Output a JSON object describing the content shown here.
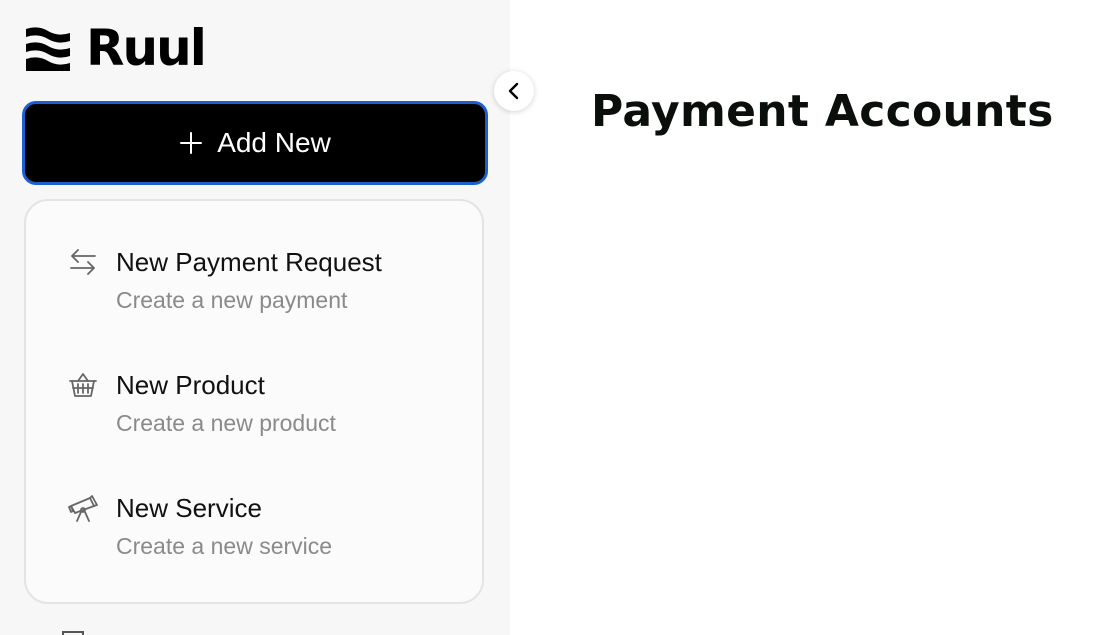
{
  "brand": {
    "name": "Ruul"
  },
  "sidebar": {
    "add_new_label": "Add New",
    "menu": [
      {
        "icon": "arrows-exchange-icon",
        "title": "New Payment Request",
        "subtitle": "Create a new payment"
      },
      {
        "icon": "basket-icon",
        "title": "New Product",
        "subtitle": "Create a new product"
      },
      {
        "icon": "telescope-icon",
        "title": "New Service",
        "subtitle": "Create a new service"
      }
    ]
  },
  "main": {
    "title": "Payment Accounts"
  },
  "colors": {
    "button_bg": "#000000",
    "button_focus_ring": "#1b5fd1",
    "sidebar_bg": "#f7f7f7",
    "subtitle_text": "#8a8a8a"
  }
}
